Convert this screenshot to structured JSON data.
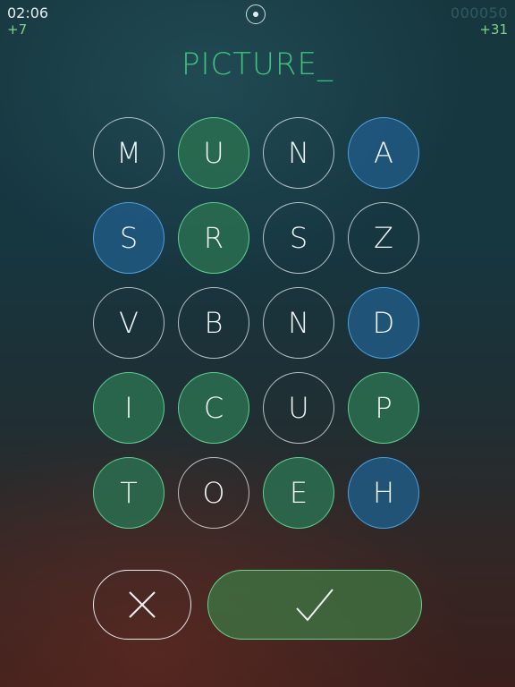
{
  "hud": {
    "time": "02:06",
    "time_bonus": "+7",
    "score": "000050",
    "score_bonus": "+31"
  },
  "current_word": "PICTURE_",
  "colors": {
    "selected_green": "#2a6e50",
    "highlight_blue": "#205880",
    "word": "#3fc27e"
  },
  "icons": {
    "menu": "menu-icon",
    "cancel": "x-icon",
    "submit": "checkmark-icon"
  },
  "grid": [
    [
      {
        "letter": "M",
        "state": "none"
      },
      {
        "letter": "U",
        "state": "green"
      },
      {
        "letter": "N",
        "state": "none"
      },
      {
        "letter": "A",
        "state": "blue"
      }
    ],
    [
      {
        "letter": "S",
        "state": "blue"
      },
      {
        "letter": "R",
        "state": "green"
      },
      {
        "letter": "S",
        "state": "none"
      },
      {
        "letter": "Z",
        "state": "none"
      }
    ],
    [
      {
        "letter": "V",
        "state": "none"
      },
      {
        "letter": "B",
        "state": "none"
      },
      {
        "letter": "N",
        "state": "none"
      },
      {
        "letter": "D",
        "state": "blue"
      }
    ],
    [
      {
        "letter": "I",
        "state": "green"
      },
      {
        "letter": "C",
        "state": "green"
      },
      {
        "letter": "U",
        "state": "none"
      },
      {
        "letter": "P",
        "state": "green"
      }
    ],
    [
      {
        "letter": "T",
        "state": "green"
      },
      {
        "letter": "O",
        "state": "none"
      },
      {
        "letter": "E",
        "state": "green"
      },
      {
        "letter": "H",
        "state": "blue"
      }
    ]
  ]
}
